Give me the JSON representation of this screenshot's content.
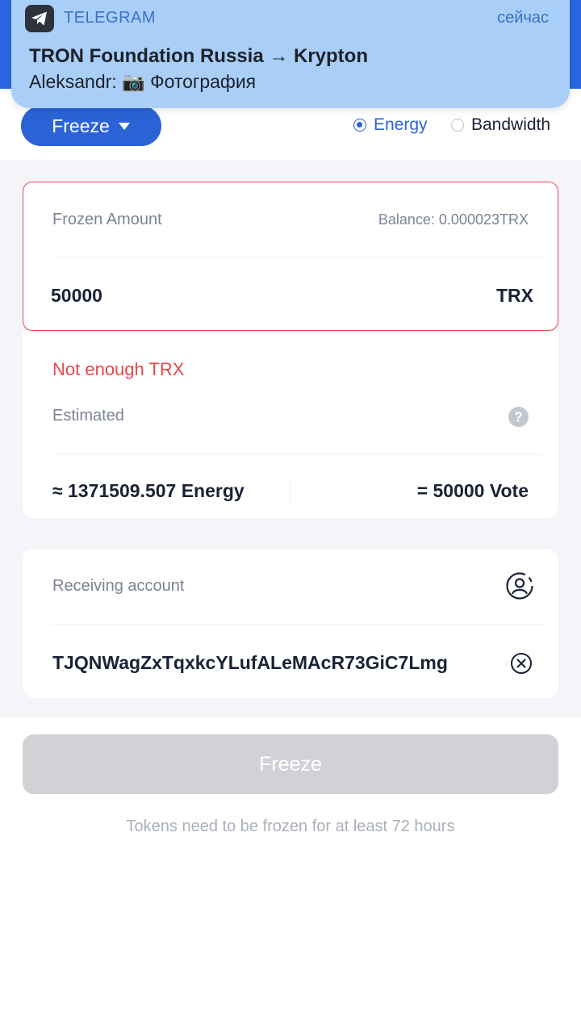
{
  "notification": {
    "app_name": "TELEGRAM",
    "time": "сейчас",
    "title": "TRON Foundation Russia → Krypton",
    "body": "Aleksandr: 📷 Фотография"
  },
  "freeze_mode": {
    "label": "Freeze"
  },
  "resource_options": [
    {
      "label": "Energy",
      "selected": true
    },
    {
      "label": "Bandwidth",
      "selected": false
    }
  ],
  "frozen_amount": {
    "label": "Frozen Amount",
    "balance": "Balance: 0.000023TRX",
    "value": "50000",
    "unit": "TRX",
    "error": "Not enough TRX"
  },
  "estimated": {
    "label": "Estimated",
    "energy": "≈ 1371509.507 Energy",
    "vote": "= 50000 Vote"
  },
  "receiving": {
    "label": "Receiving account",
    "address": "TJQNWagZxTqxkcYLufALeMAcR73GiC7Lmg"
  },
  "submit": {
    "label": "Freeze"
  },
  "hint": "Tokens need to be frozen for at least 72 hours",
  "colors": {
    "accent": "#2b63d6",
    "error": "#e5484d",
    "disabled": "#d0d2d6"
  }
}
